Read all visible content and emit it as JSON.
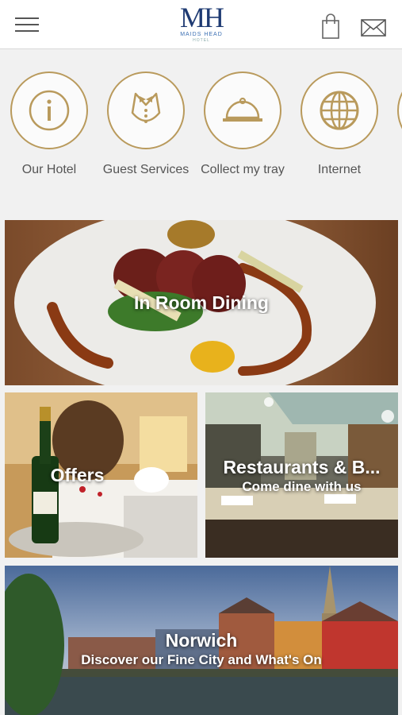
{
  "header": {
    "logo_mark": "MH",
    "logo_text": "MAIDS HEAD",
    "logo_subtext": "HOTEL",
    "menu_icon": "hamburger-menu-icon",
    "bag_icon": "shopping-bag-icon",
    "mail_icon": "envelope-icon"
  },
  "categories": [
    {
      "label": "Our Hotel",
      "icon": "info-icon"
    },
    {
      "label": "Guest Services",
      "icon": "butler-icon"
    },
    {
      "label": "Collect my tray",
      "icon": "cloche-icon"
    },
    {
      "label": "Internet",
      "icon": "globe-icon"
    }
  ],
  "tiles": {
    "dining": {
      "title": "In Room Dining"
    },
    "offers": {
      "title": "Offers"
    },
    "restaurants": {
      "title": "Restaurants & B...",
      "subtitle": "Come dine with us"
    },
    "norwich": {
      "title": "Norwich",
      "subtitle": "Discover our Fine City and What's On"
    }
  },
  "colors": {
    "accent_gold": "#b99a5c",
    "logo_navy": "#1f3b73",
    "background": "#f1f1f1"
  }
}
